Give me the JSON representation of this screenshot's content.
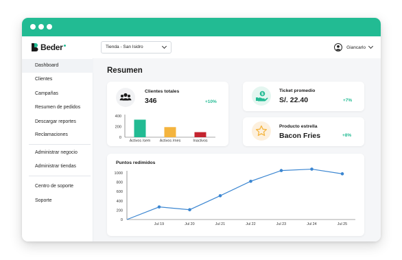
{
  "brand": {
    "name": "Beder",
    "accent": "#22bb93"
  },
  "topbar": {
    "store_value": "Tienda - San Isidro",
    "user_name": "Giancarlo"
  },
  "sidebar": {
    "groups": [
      [
        "Dashboard",
        "Clientes",
        "Campañas",
        "Resumen de pedidos",
        "Descargar reportes",
        "Reclamaciones"
      ],
      [
        "Administrar negocio",
        "Administrar tiendas"
      ],
      [
        "Centro de soporte",
        "Soporte"
      ]
    ],
    "active": "Dashboard"
  },
  "page": {
    "title": "Resumen"
  },
  "cards": {
    "clientes": {
      "title": "Clientes totales",
      "value": "346",
      "delta": "+10%"
    },
    "ticket": {
      "title": "Ticket promedio",
      "value": "S/. 22.40",
      "delta": "+7%"
    },
    "producto": {
      "title": "Producto estrella",
      "value": "Bacon Fries",
      "delta": "+8%"
    }
  },
  "chart_data": [
    {
      "type": "bar",
      "categories": [
        "Activos /sem",
        "Activos /mes",
        "Inactivos"
      ],
      "values": [
        330,
        190,
        95
      ],
      "colors": [
        "#22bb93",
        "#f4b43e",
        "#c4242f"
      ],
      "yticks": [
        0,
        200,
        400
      ],
      "ylim": [
        0,
        400
      ]
    },
    {
      "type": "line",
      "title": "Puntos redimidos",
      "x": [
        "Jul 19",
        "Jul 20",
        "Jul 21",
        "Jul 22",
        "Jul 23",
        "Jul 24",
        "Jul 25"
      ],
      "values": [
        270,
        210,
        510,
        820,
        1050,
        1080,
        980
      ],
      "start_value": 0,
      "yticks": [
        0,
        200,
        400,
        600,
        800,
        1000
      ],
      "ylim": [
        0,
        1000
      ],
      "color": "#3b86d1"
    }
  ]
}
